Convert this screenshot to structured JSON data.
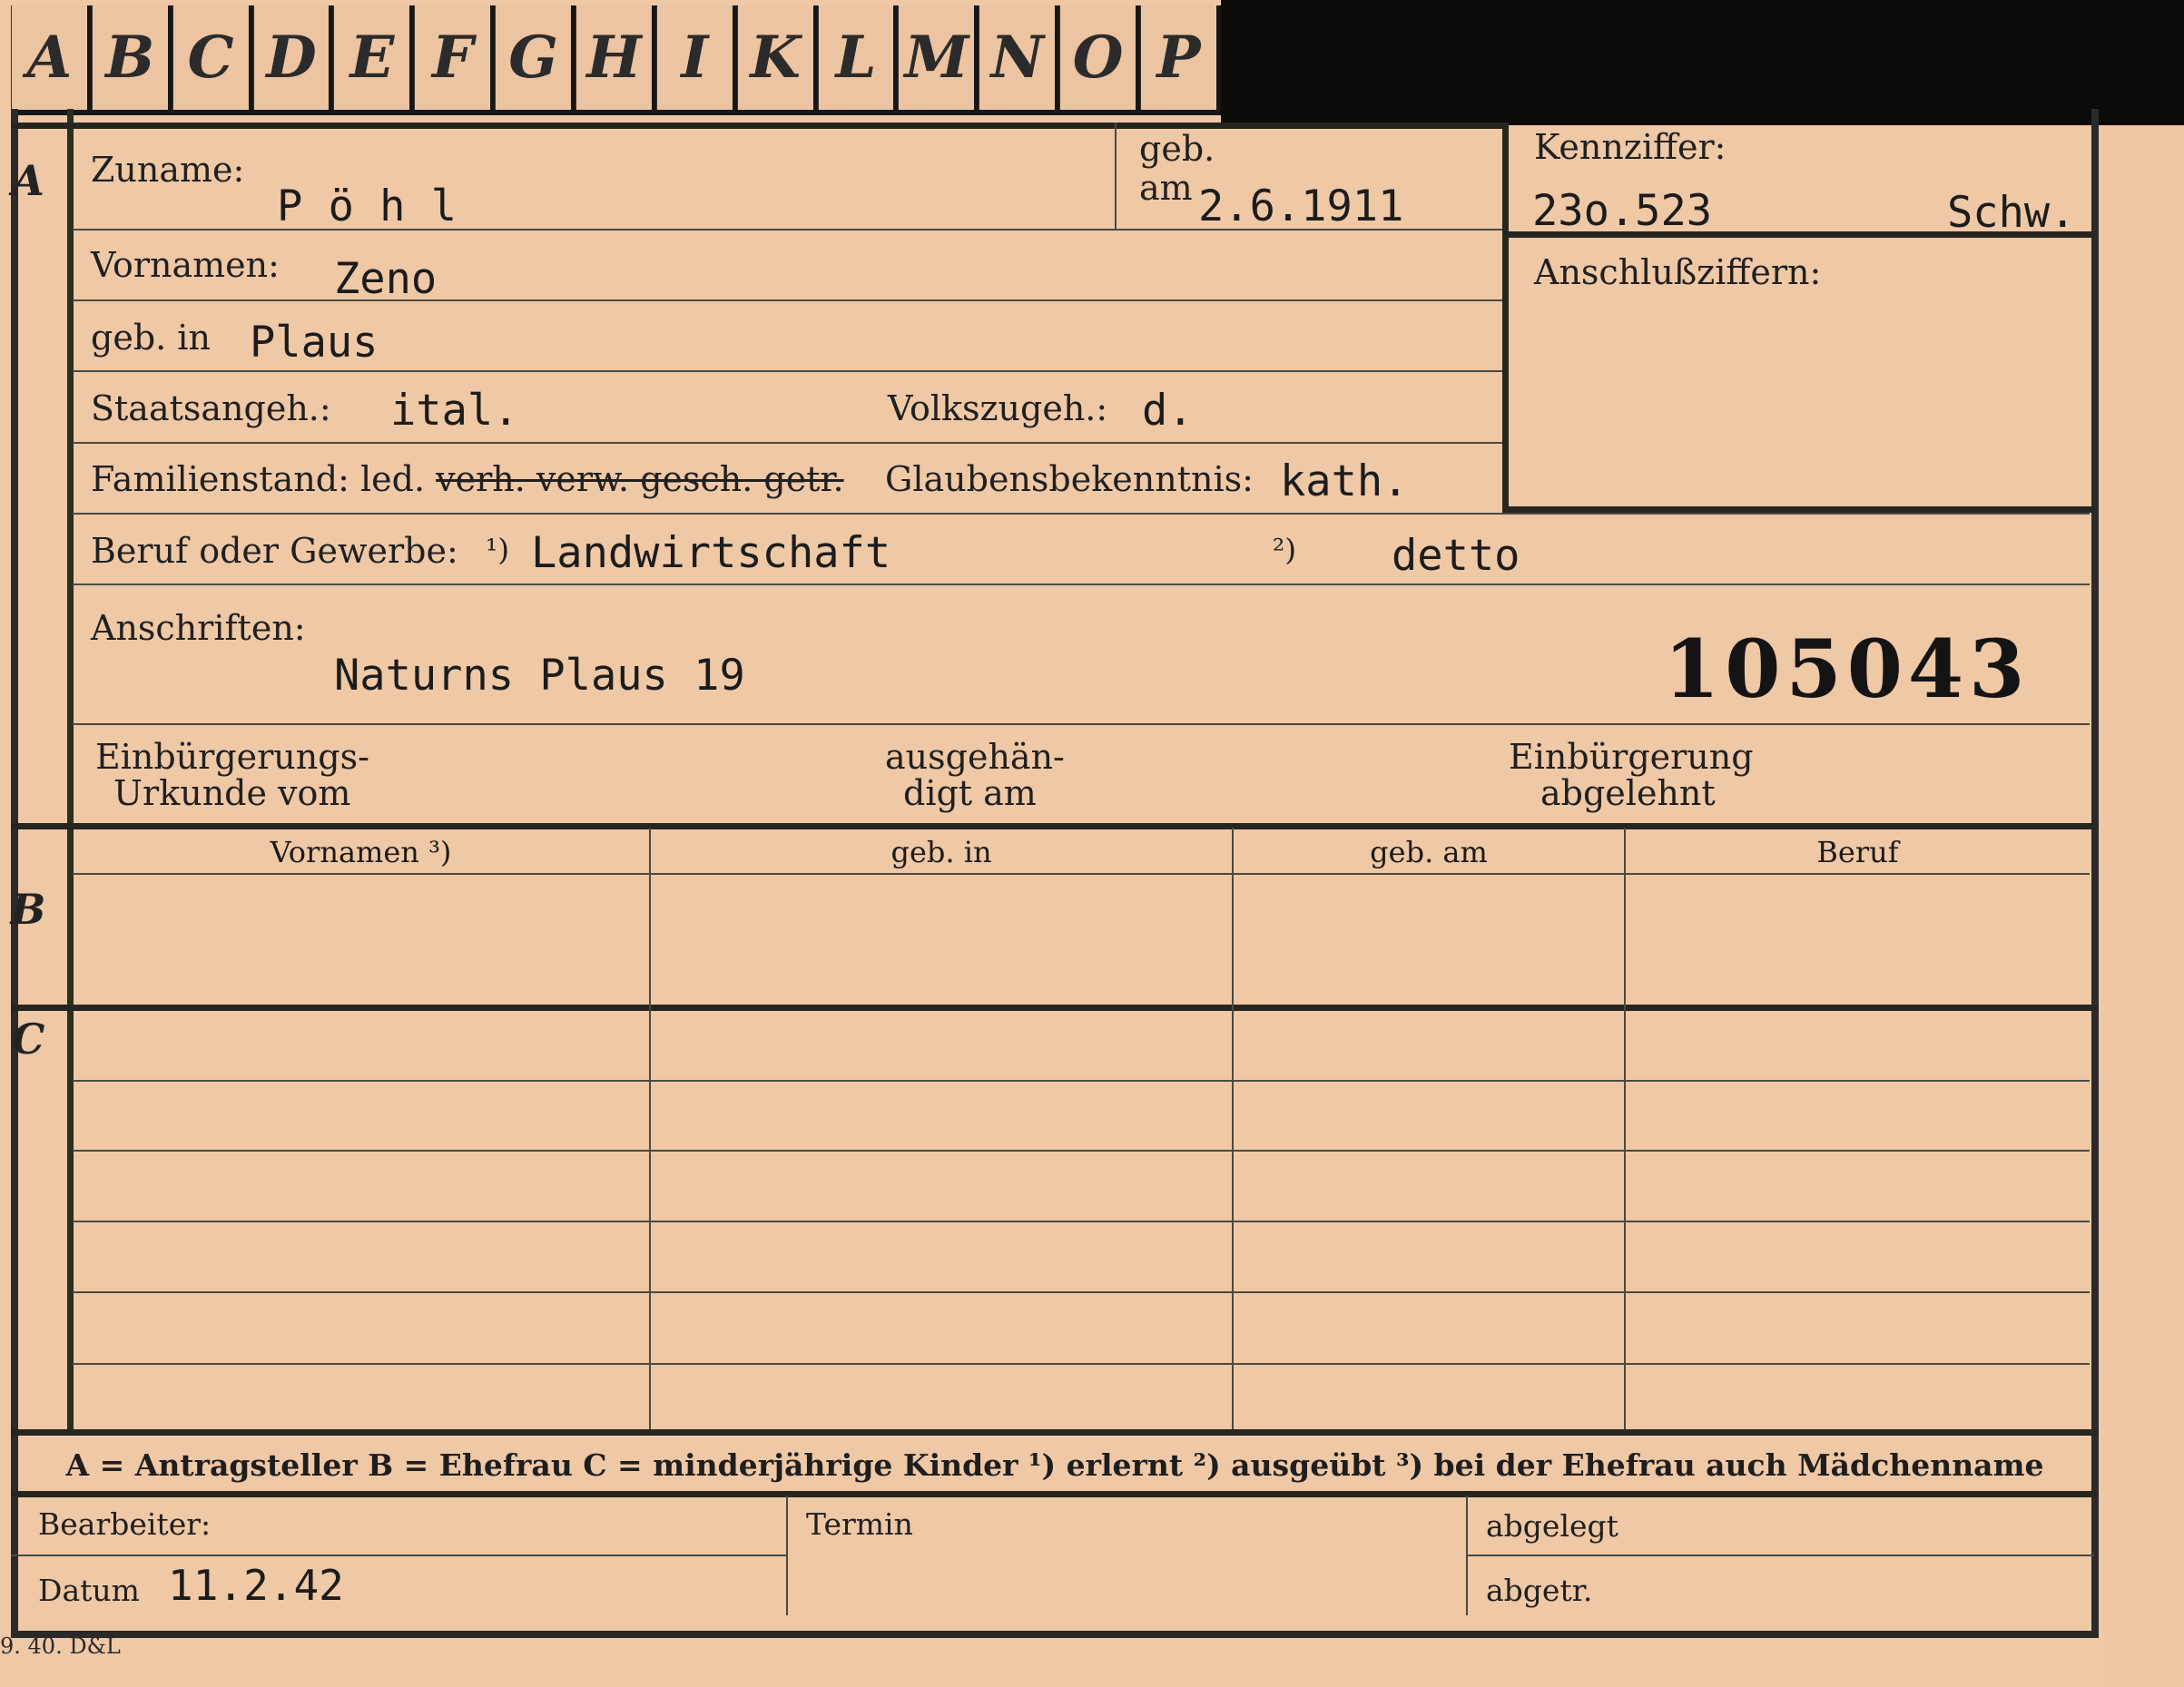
{
  "tabs": [
    "A",
    "B",
    "C",
    "D",
    "E",
    "F",
    "G",
    "H",
    "I",
    "K",
    "L",
    "M",
    "N",
    "O",
    "P"
  ],
  "sections": {
    "a": "A",
    "b": "B",
    "c": "C"
  },
  "labels": {
    "zuname": "Zuname:",
    "geb": "geb.",
    "am": "am",
    "kennziffer": "Kennziffer:",
    "anschlussziffern": "Anschlußziffern:",
    "vornamen": "Vornamen:",
    "geb_in": "geb. in",
    "staatsangeh": "Staatsangeh.:",
    "volkszugeh": "Volkszugeh.:",
    "familienstand": "Familienstand: led.",
    "familienstand_struck": "verh. verw. gesch. getr.",
    "glaubensbekenntnis": "Glaubensbekenntnis:",
    "beruf": "Beruf oder Gewerbe:",
    "beruf_note1": "¹)",
    "beruf_note2": "²)",
    "anschriften": "Anschriften:",
    "urkunde_line1": "Einbürgerungs-",
    "urkunde_line2": "Urkunde vom",
    "ausgehaendigt_line1": "ausgehän-",
    "ausgehaendigt_line2": "digt am",
    "abgelehnt_line1": "Einbürgerung",
    "abgelehnt_line2": "abgelehnt",
    "bearbeiter": "Bearbeiter:",
    "datum": "Datum",
    "termin": "Termin",
    "abgelegt": "abgelegt",
    "abgetr": "abgetr."
  },
  "values": {
    "zuname": "P ö h l",
    "geb_am": "2.6.1911",
    "kennziffer": "23o.523",
    "kennziffer_suffix": "Schw.",
    "vornamen": "Zeno",
    "geb_in": "Plaus",
    "staatsangeh": "ital.",
    "volkszugeh": "d.",
    "glaubensbekenntnis": "kath.",
    "beruf_erlernt": "Landwirtschaft",
    "beruf_ausgeuebt": "detto",
    "anschrift": "Naturns Plaus 19",
    "card_number": "105043",
    "datum": "11.2.42"
  },
  "table_headers": [
    "Vornamen ³)",
    "geb. in",
    "geb. am",
    "Beruf"
  ],
  "legend": "A = Antragsteller   B = Ehefrau   C = minderjährige Kinder   ¹) erlernt   ²) ausgeübt   ³) bei der Ehefrau auch Mädchenname",
  "print_code": "9. 40. D&L"
}
